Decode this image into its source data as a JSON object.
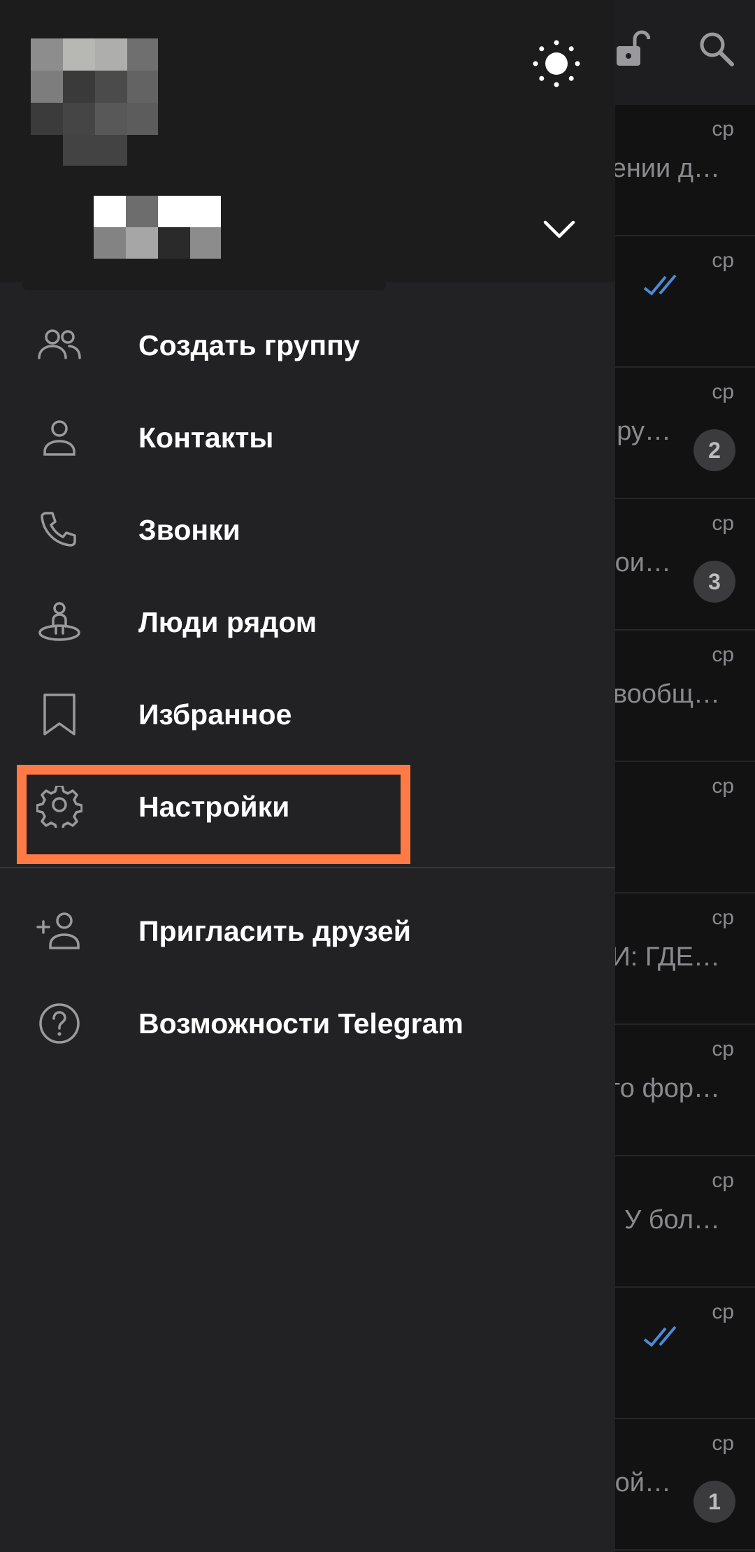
{
  "drawer": {
    "menu": [
      {
        "key": "new_group",
        "label": "Создать группу",
        "icon": "group-icon"
      },
      {
        "key": "contacts",
        "label": "Контакты",
        "icon": "person-icon"
      },
      {
        "key": "calls",
        "label": "Звонки",
        "icon": "phone-icon"
      },
      {
        "key": "nearby",
        "label": "Люди рядом",
        "icon": "people-nearby-icon"
      },
      {
        "key": "saved",
        "label": "Избранное",
        "icon": "bookmark-icon"
      },
      {
        "key": "settings",
        "label": "Настройки",
        "icon": "gear-icon"
      }
    ],
    "menu2": [
      {
        "key": "invite",
        "label": "Пригласить друзей",
        "icon": "add-person-icon"
      },
      {
        "key": "features",
        "label": "Возможности Telegram",
        "icon": "question-icon"
      }
    ]
  },
  "chats": [
    {
      "time": "ср",
      "preview": "ении д…"
    },
    {
      "time": "ср",
      "preview": "",
      "read": true
    },
    {
      "time": "ср",
      "preview": "ру…",
      "badge": "2"
    },
    {
      "time": "ср",
      "preview": "ои…",
      "badge": "3"
    },
    {
      "time": "ср",
      "preview": "вообщ…"
    },
    {
      "time": "ср",
      "preview": ""
    },
    {
      "time": "ср",
      "preview": "И: ГДЕ…"
    },
    {
      "time": "ср",
      "preview": "го фор…"
    },
    {
      "time": "ср",
      "preview": "У бол…"
    },
    {
      "time": "ср",
      "preview": "",
      "read": true
    },
    {
      "time": "ср",
      "preview": "ой…",
      "badge": "1"
    }
  ],
  "colors": {
    "highlight": "#ff7a45",
    "drawer_bg": "#222224",
    "header_bg": "#1c1c1d",
    "read_check": "#4c8bd6"
  }
}
